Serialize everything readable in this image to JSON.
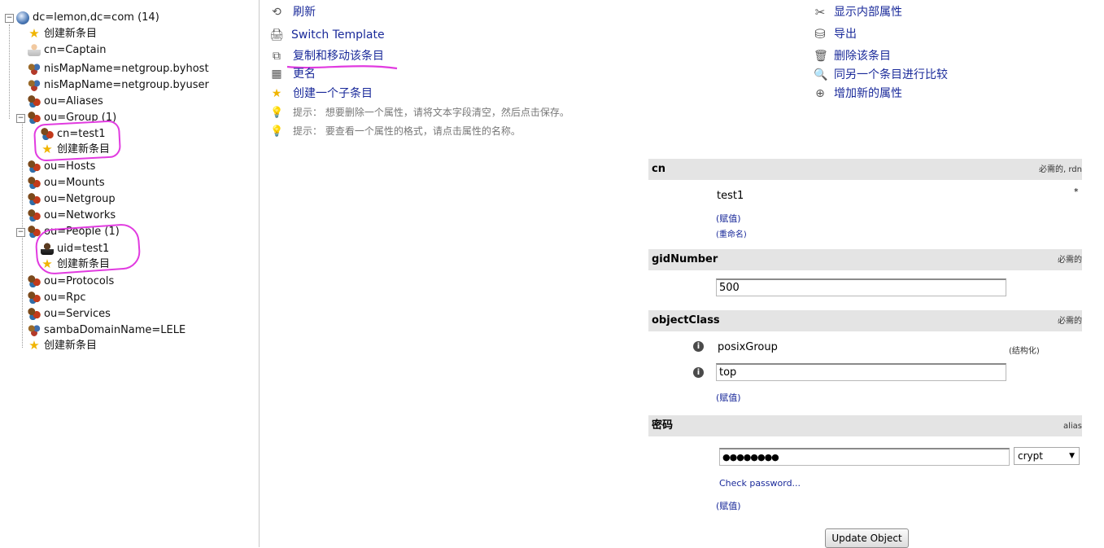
{
  "tree": {
    "root": {
      "label": "dc=lemon,dc=com (14)"
    },
    "items": [
      {
        "label": "创建新条目",
        "icon": "star-icon"
      },
      {
        "label": "cn=Captain",
        "icon": "person-icon"
      },
      {
        "label": "nisMapName=netgroup.byhost",
        "icon": "map-icon"
      },
      {
        "label": "nisMapName=netgroup.byuser",
        "icon": "map-icon"
      },
      {
        "label": "ou=Aliases",
        "icon": "ou-icon"
      },
      {
        "label": "ou=Group (1)",
        "icon": "ou-icon"
      },
      {
        "label": "cn=test1",
        "icon": "group-entry-icon"
      },
      {
        "label": "创建新条目",
        "icon": "star-icon"
      },
      {
        "label": "ou=Hosts",
        "icon": "ou-icon"
      },
      {
        "label": "ou=Mounts",
        "icon": "ou-icon"
      },
      {
        "label": "ou=Netgroup",
        "icon": "ou-icon"
      },
      {
        "label": "ou=Networks",
        "icon": "ou-icon"
      },
      {
        "label": "ou=People (1)",
        "icon": "ou-icon"
      },
      {
        "label": "uid=test1",
        "icon": "user-icon"
      },
      {
        "label": "创建新条目",
        "icon": "star-icon"
      },
      {
        "label": "ou=Protocols",
        "icon": "ou-icon"
      },
      {
        "label": "ou=Rpc",
        "icon": "ou-icon"
      },
      {
        "label": "ou=Services",
        "icon": "ou-icon"
      },
      {
        "label": "sambaDomainName=LELE",
        "icon": "map-icon"
      },
      {
        "label": "创建新条目",
        "icon": "star-icon"
      }
    ]
  },
  "actions_left": [
    {
      "label": "刷新",
      "icon": "refresh-icon"
    },
    {
      "label": "Switch Template",
      "icon": "template-icon"
    },
    {
      "label": "复制和移动该条目",
      "icon": "copy-icon"
    },
    {
      "label": "更名",
      "icon": "rename-icon"
    },
    {
      "label": "创建一个子条目",
      "icon": "star-icon"
    }
  ],
  "hints": [
    "提示： 想要删除一个属性，请将文本字段清空，然后点击保存。",
    "提示： 要查看一个属性的格式，请点击属性的名称。"
  ],
  "actions_right": [
    {
      "label": "显示内部属性",
      "icon": "tools-icon"
    },
    {
      "label": "导出",
      "icon": "export-icon"
    },
    {
      "label": "删除该条目",
      "icon": "trash-icon"
    },
    {
      "label": "同另一个条目进行比较",
      "icon": "compare-icon"
    },
    {
      "label": "增加新的属性",
      "icon": "add-attribute-icon"
    }
  ],
  "form": {
    "cn": {
      "name": "cn",
      "note": "必需的, rdn",
      "value": "test1",
      "star": "*",
      "add_value": "(赋值)",
      "rename": "(重命名)"
    },
    "gidNumber": {
      "name": "gidNumber",
      "note": "必需的",
      "value": "500"
    },
    "objectClass": {
      "name": "objectClass",
      "note": "必需的",
      "values": [
        "posixGroup",
        "top"
      ],
      "structural": "(结构化)",
      "add_value": "(赋值)"
    },
    "password": {
      "name": "密码",
      "note": "alias",
      "value": "●●●●●●●●",
      "hash": "crypt",
      "check": "Check password...",
      "add_value": "(赋值)"
    },
    "submit": "Update Object"
  },
  "colors": {
    "annotation": "#e13be0",
    "link": "#1a2a9a",
    "header_bg": "#e4e4e4"
  }
}
